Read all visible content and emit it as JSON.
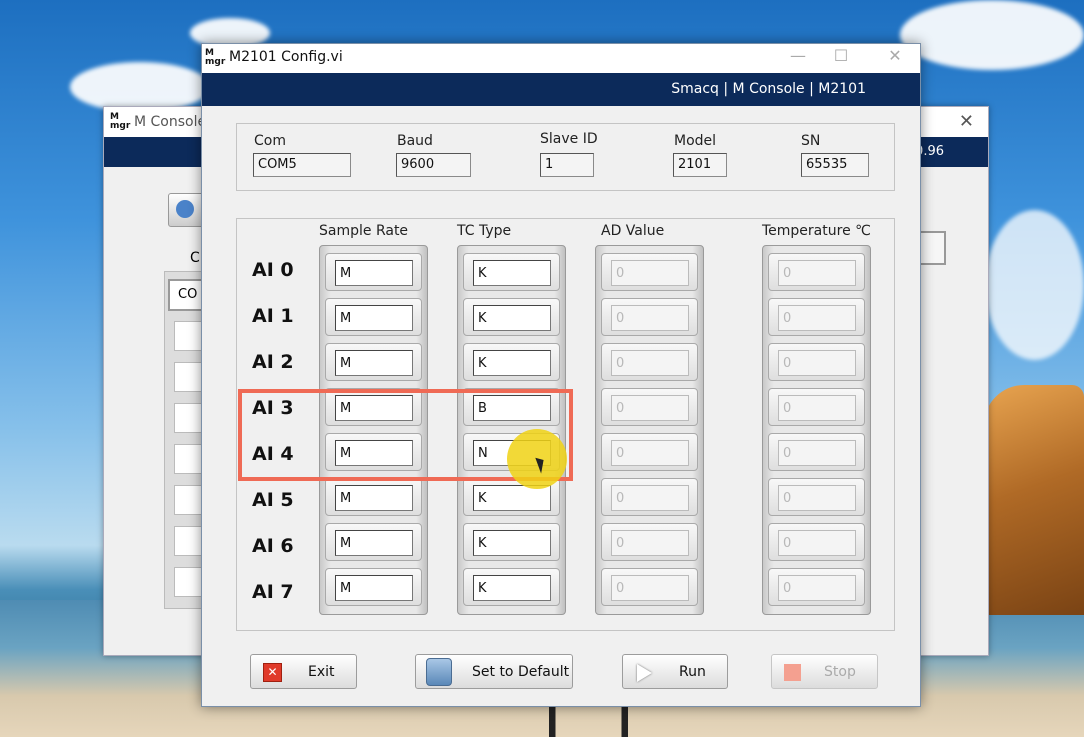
{
  "bg_window": {
    "title": "M Console",
    "band_text": "0.96",
    "com_label": "C",
    "com_value": "CO",
    "close": "✕"
  },
  "window": {
    "title": "M2101 Config.vi",
    "logo_top": "M",
    "logo_bottom": "mgr",
    "minimize": "—",
    "maximize": "☐",
    "close": "✕"
  },
  "header_band": "Smacq | M Console | M2101",
  "device": {
    "com_label": "Com",
    "com_value": "COM5",
    "baud_label": "Baud",
    "baud_value": "9600",
    "slave_label": "Slave ID",
    "slave_value": "1",
    "model_label": "Model",
    "model_value": "2101",
    "sn_label": "SN",
    "sn_value": "65535"
  },
  "columns": {
    "sample_rate": "Sample Rate",
    "tc_type": "TC Type",
    "ad_value": "AD Value",
    "temperature": "Temperature ℃"
  },
  "channels": [
    {
      "label": "AI 0",
      "sample_rate": "M",
      "tc_type": "K",
      "ad": "0",
      "temp": "0"
    },
    {
      "label": "AI 1",
      "sample_rate": "M",
      "tc_type": "K",
      "ad": "0",
      "temp": "0"
    },
    {
      "label": "AI 2",
      "sample_rate": "M",
      "tc_type": "K",
      "ad": "0",
      "temp": "0"
    },
    {
      "label": "AI 3",
      "sample_rate": "M",
      "tc_type": "B",
      "ad": "0",
      "temp": "0"
    },
    {
      "label": "AI 4",
      "sample_rate": "M",
      "tc_type": "N",
      "ad": "0",
      "temp": "0"
    },
    {
      "label": "AI 5",
      "sample_rate": "M",
      "tc_type": "K",
      "ad": "0",
      "temp": "0"
    },
    {
      "label": "AI 6",
      "sample_rate": "M",
      "tc_type": "K",
      "ad": "0",
      "temp": "0"
    },
    {
      "label": "AI 7",
      "sample_rate": "M",
      "tc_type": "K",
      "ad": "0",
      "temp": "0"
    }
  ],
  "buttons": {
    "exit": "Exit",
    "default": "Set to Default",
    "run": "Run",
    "stop": "Stop"
  },
  "colors": {
    "band": "#0c2a5a",
    "highlight": "#ef6a55",
    "exit_icon": "#e03a2a",
    "stop_icon": "#f4a090"
  }
}
